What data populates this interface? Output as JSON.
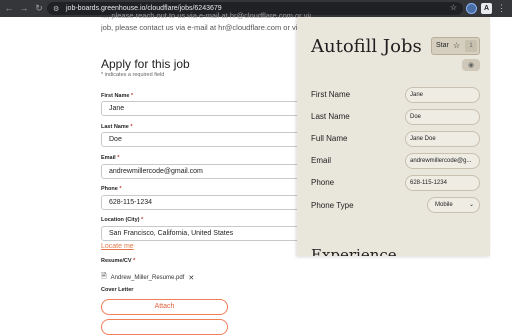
{
  "browser": {
    "url": "job-boards.greenhouse.io/cloudflare/jobs/6243679",
    "back_icon": "back-arrow-icon",
    "forward_icon": "forward-arrow-icon",
    "reload_icon": "reload-icon"
  },
  "page": {
    "intro_line_1": "..., please reach out to us via e-mail at hr@cloudflare.com or via",
    "intro_line_2": "job, please contact us via e-mail at hr@cloudflare.com or via m",
    "apply_title": "Apply for this job",
    "required_note": "* indicates a required field",
    "fields": {
      "first_name": {
        "label": "First Name",
        "value": "Jane"
      },
      "last_name": {
        "label": "Last Name",
        "value": "Doe"
      },
      "email": {
        "label": "Email",
        "value": "andrewmillercode@gmail.com"
      },
      "phone": {
        "label": "Phone",
        "value": "628-115-1234"
      },
      "location": {
        "label": "Location (City)",
        "value": "San Francisco, California, United States"
      }
    },
    "locate_me": "Locate me",
    "resume_label": "Resume/CV",
    "resume_file": "Andrew_Miller_Resume.pdf",
    "cover_letter_label": "Cover Letter",
    "attach_label": "Attach",
    "asterisk": "*"
  },
  "extension": {
    "title": "Autofill Jobs",
    "star_label": "Star",
    "star_count": "1",
    "fields": [
      {
        "label": "First Name",
        "value": "Jane"
      },
      {
        "label": "Last Name",
        "value": "Doe"
      },
      {
        "label": "Full Name",
        "value": "Jane Doe"
      },
      {
        "label": "Email",
        "value": "andrewmillercode@g..."
      },
      {
        "label": "Phone",
        "value": "628-115-1234"
      }
    ],
    "phone_type": {
      "label": "Phone Type",
      "value": "Mobile"
    },
    "section_title": "Experience"
  },
  "colors": {
    "accent": "#e0603b",
    "panel_bg": "#e9e6dc",
    "chrome_bg": "#35363a"
  }
}
